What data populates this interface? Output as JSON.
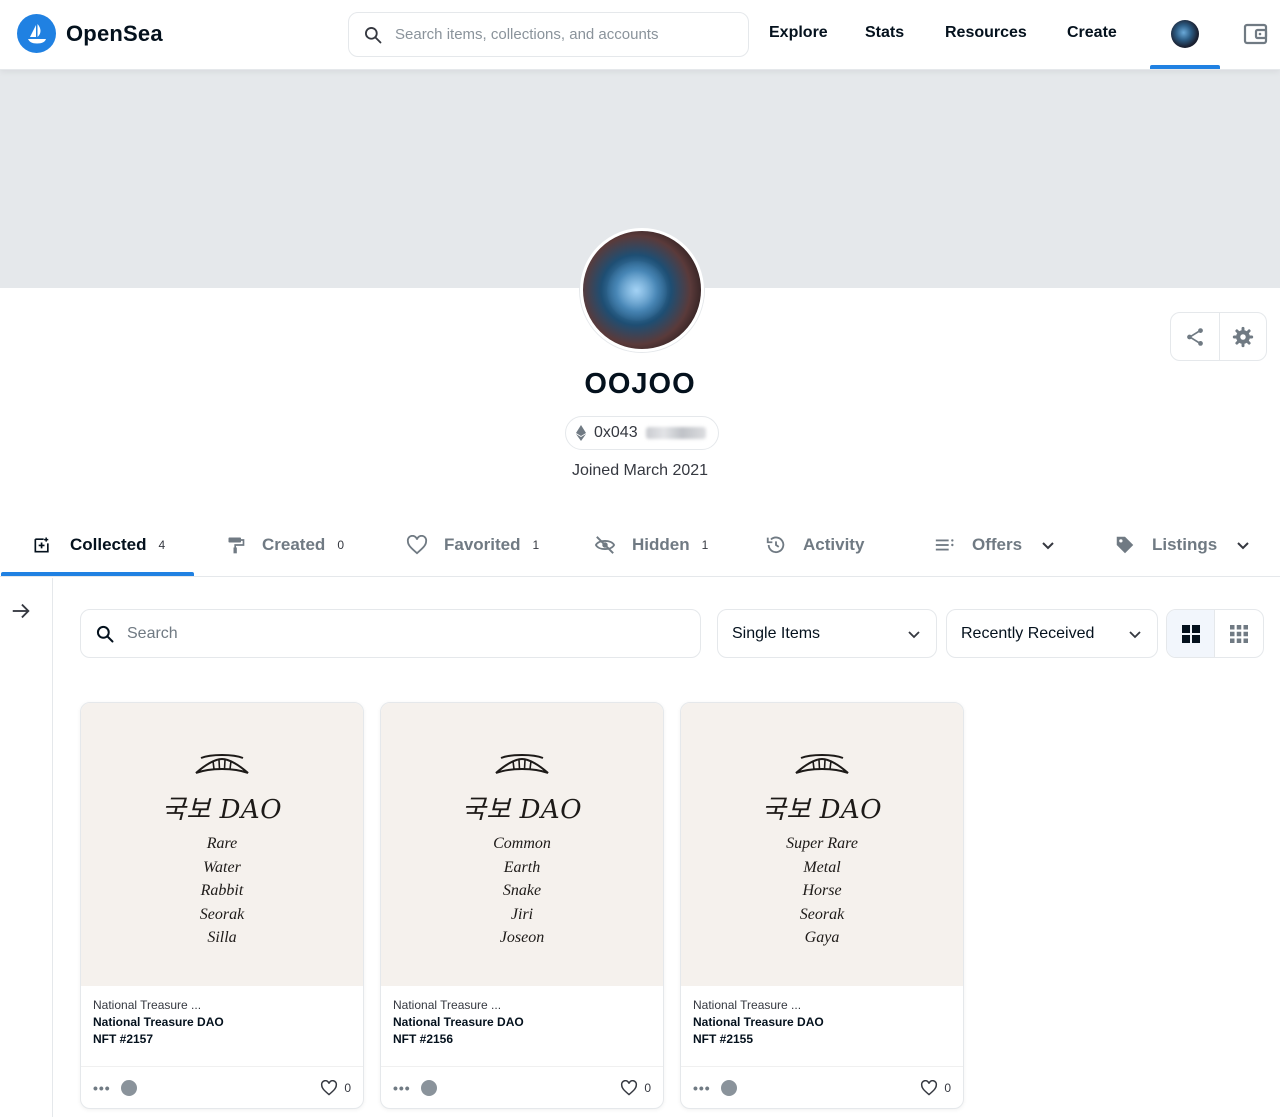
{
  "header": {
    "brand": "OpenSea",
    "search_placeholder": "Search items, collections, and accounts",
    "nav": [
      "Explore",
      "Stats",
      "Resources",
      "Create"
    ]
  },
  "profile": {
    "name": "OOJOO",
    "address": "0x043",
    "joined": "Joined March 2021"
  },
  "tabs": [
    {
      "label": "Collected",
      "count": "4"
    },
    {
      "label": "Created",
      "count": "0"
    },
    {
      "label": "Favorited",
      "count": "1"
    },
    {
      "label": "Hidden",
      "count": "1"
    },
    {
      "label": "Activity"
    },
    {
      "label": "Offers"
    },
    {
      "label": "Listings"
    }
  ],
  "filters": {
    "search_placeholder": "Search",
    "item_type": "Single Items",
    "sort": "Recently Received"
  },
  "cards": [
    {
      "art_title": "국보 DAO",
      "traits": [
        "Rare",
        "Water",
        "Rabbit",
        "Seorak",
        "Silla"
      ],
      "collection": "National Treasure ...",
      "name": "National Treasure DAO",
      "nft": "NFT #2157",
      "likes": "0"
    },
    {
      "art_title": "국보 DAO",
      "traits": [
        "Common",
        "Earth",
        "Snake",
        "Jiri",
        "Joseon"
      ],
      "collection": "National Treasure ...",
      "name": "National Treasure DAO",
      "nft": "NFT #2156",
      "likes": "0"
    },
    {
      "art_title": "국보 DAO",
      "traits": [
        "Super Rare",
        "Metal",
        "Horse",
        "Seorak",
        "Gaya"
      ],
      "collection": "National Treasure ...",
      "name": "National Treasure DAO",
      "nft": "NFT #2155",
      "likes": "0"
    }
  ],
  "colors": {
    "accent": "#2081e2",
    "banner": "#e5e8eb",
    "art_bg": "#f5f1ed"
  }
}
